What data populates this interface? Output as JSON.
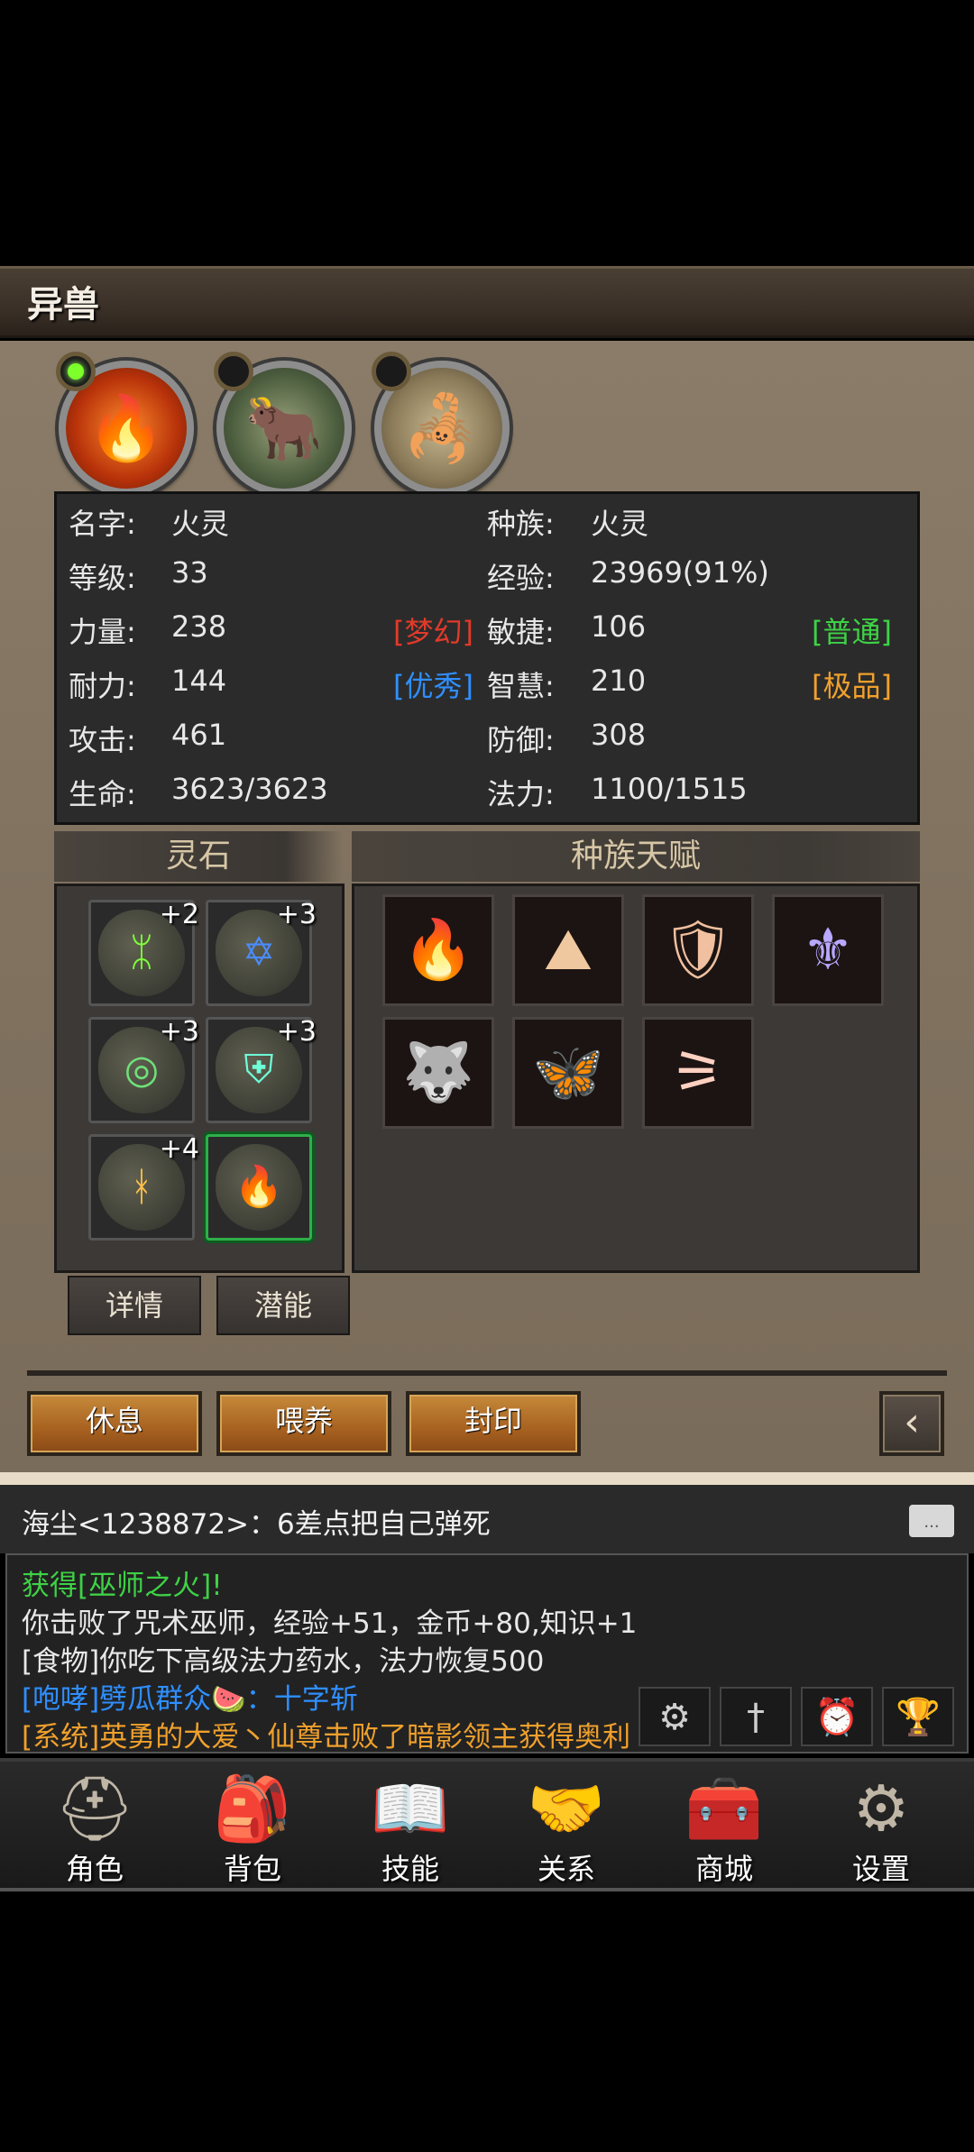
{
  "header": {
    "title": "异兽"
  },
  "pets": [
    {
      "icon": "fire-spirit-icon",
      "glyph": "🔥",
      "active": true
    },
    {
      "icon": "minotaur-icon",
      "glyph": "🐂",
      "active": false
    },
    {
      "icon": "scorpion-icon",
      "glyph": "🦂",
      "active": false
    }
  ],
  "stats": {
    "name_label": "名字:",
    "name_value": "火灵",
    "race_label": "种族:",
    "race_value": "火灵",
    "level_label": "等级:",
    "level_value": "33",
    "exp_label": "经验:",
    "exp_value": "23969(91%)",
    "str_label": "力量:",
    "str_value": "238",
    "str_quality": "[梦幻]",
    "agi_label": "敏捷:",
    "agi_value": "106",
    "agi_quality": "[普通]",
    "end_label": "耐力:",
    "end_value": "144",
    "end_quality": "[优秀]",
    "wis_label": "智慧:",
    "wis_value": "210",
    "wis_quality": "[极品]",
    "atk_label": "攻击:",
    "atk_value": "461",
    "def_label": "防御:",
    "def_value": "308",
    "hp_label": "生命:",
    "hp_value": "3623/3623",
    "mp_label": "法力:",
    "mp_value": "1100/1515"
  },
  "spirit_stones": {
    "title": "灵石",
    "items": [
      {
        "level": "+2",
        "icon": "green-rune-stone-icon",
        "glyph": "ᛯ",
        "color": "#7dff3a"
      },
      {
        "level": "+3",
        "icon": "blue-rune-stone-icon",
        "glyph": "✡",
        "color": "#4a8cff"
      },
      {
        "level": "+3",
        "icon": "green-swirl-stone-icon",
        "glyph": "◎",
        "color": "#6ee07a"
      },
      {
        "level": "+3",
        "icon": "shield-stone-icon",
        "glyph": "⛨",
        "color": "#6fffd8"
      },
      {
        "level": "+4",
        "icon": "gold-rune-stone-icon",
        "glyph": "ᚼ",
        "color": "#ffc04a"
      },
      {
        "level": "",
        "icon": "fire-stone-icon",
        "glyph": "🔥",
        "color": "#ffb02a"
      }
    ],
    "detail_button": "详情",
    "potential_button": "潜能"
  },
  "race_talents": {
    "title": "种族天赋",
    "items": [
      {
        "icon": "flame-talent-icon",
        "glyph": "🔥",
        "color": "#ff9a6a"
      },
      {
        "icon": "mountain-talent-icon",
        "glyph": "⛰",
        "color": "#f0c8a0"
      },
      {
        "icon": "fire-shield-talent-icon",
        "glyph": "🛡",
        "color": "#f0c0a0"
      },
      {
        "icon": "wings-talent-icon",
        "glyph": "⚜",
        "color": "#b8a8ff"
      },
      {
        "icon": "werewolf-talent-icon",
        "glyph": "🐺",
        "color": "#ff8a8a"
      },
      {
        "icon": "butterfly-talent-icon",
        "glyph": "🦋",
        "color": "#e08ab0"
      },
      {
        "icon": "fangs-talent-icon",
        "glyph": "⚞",
        "color": "#ffd0c0"
      }
    ]
  },
  "actions": {
    "rest": "休息",
    "feed": "喂养",
    "seal": "封印",
    "back_icon": "back-arrow-icon"
  },
  "chat": {
    "top_message": "海尘<1238872>：6差点把自己弹死",
    "lines": [
      {
        "text": "获得[巫师之火]!",
        "color": "#3ed246"
      },
      {
        "text": "你击败了咒术巫师，经验+51，金币+80,知识+1",
        "color": "#e8e8e8"
      },
      {
        "text": "[食物]你吃下高级法力药水，法力恢复500",
        "color": "#e8e8e8"
      },
      {
        "text": "[咆哮]劈瓜群众🍉：十字斩",
        "color": "#2f8fff"
      },
      {
        "text": "[系统]英勇的大爱丶仙尊击败了暗影领主获得奥利",
        "color": "#f0a02c"
      }
    ],
    "tools": [
      {
        "icon": "crossed-swords-gear-icon",
        "glyph": "⚙"
      },
      {
        "icon": "sword-icon",
        "glyph": "†"
      },
      {
        "icon": "alarm-clock-icon",
        "glyph": "⏰"
      },
      {
        "icon": "trophy-icon",
        "glyph": "🏆"
      }
    ]
  },
  "nav": [
    {
      "label": "角色",
      "icon": "helmet-icon",
      "glyph": "⛑"
    },
    {
      "label": "背包",
      "icon": "backpack-icon",
      "glyph": "🎒"
    },
    {
      "label": "技能",
      "icon": "skill-book-icon",
      "glyph": "📖"
    },
    {
      "label": "关系",
      "icon": "handshake-icon",
      "glyph": "🤝"
    },
    {
      "label": "商城",
      "icon": "treasure-chest-icon",
      "glyph": "🧰"
    },
    {
      "label": "设置",
      "icon": "settings-gear-icon",
      "glyph": "⚙"
    }
  ]
}
